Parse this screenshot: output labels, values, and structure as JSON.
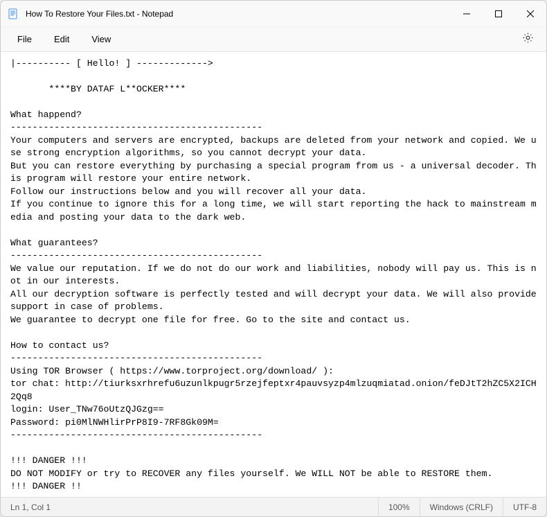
{
  "titlebar": {
    "title": "How To Restore Your Files.txt - Notepad"
  },
  "menubar": {
    "file": "File",
    "edit": "Edit",
    "view": "View"
  },
  "content": "|---------- [ Hello! ] ------------->\n\n       ****BY DATAF L**OCKER****\n\nWhat happend?\n----------------------------------------------\nYour computers and servers are encrypted, backups are deleted from your network and copied. We use strong encryption algorithms, so you cannot decrypt your data.\nBut you can restore everything by purchasing a special program from us - a universal decoder. This program will restore your entire network.\nFollow our instructions below and you will recover all your data.\nIf you continue to ignore this for a long time, we will start reporting the hack to mainstream media and posting your data to the dark web.\n\nWhat guarantees?\n----------------------------------------------\nWe value our reputation. If we do not do our work and liabilities, nobody will pay us. This is not in our interests.\nAll our decryption software is perfectly tested and will decrypt your data. We will also provide support in case of problems.\nWe guarantee to decrypt one file for free. Go to the site and contact us.\n\nHow to contact us?\n----------------------------------------------\nUsing TOR Browser ( https://www.torproject.org/download/ ):\ntor chat: http://tiurksxrhrefu6uzunlkpugr5rzejfeptxr4pauvsyzp4mlzuqmiatad.onion/feDJtT2hZC5X2ICH2Qq8\nlogin: User_TNw76oUtzQJGzg==\nPassword: pi0MlNWHlirPrP8I9-7RF8Gk09M=\n----------------------------------------------\n\n!!! DANGER !!!\nDO NOT MODIFY or try to RECOVER any files yourself. We WILL NOT be able to RESTORE them.\n!!! DANGER !!",
  "statusbar": {
    "position": "Ln 1, Col 1",
    "zoom": "100%",
    "line_ending": "Windows (CRLF)",
    "encoding": "UTF-8"
  }
}
